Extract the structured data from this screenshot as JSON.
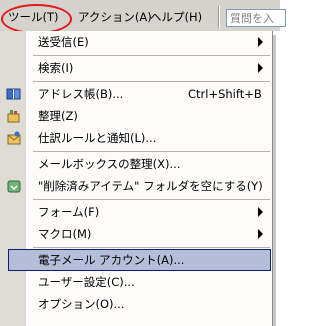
{
  "menubar": {
    "tools_label": "ツール(T)",
    "action_label": "アクション(A)",
    "help_label": "ヘルプ(H)",
    "question_placeholder": "質問を入"
  },
  "menu": {
    "send_receive": "送受信(E)",
    "search": "検索(I)",
    "address_book": "アドレス帳(B)...",
    "address_book_shortcut": "Ctrl+Shift+B",
    "organize": "整理(Z)",
    "rules_alerts": "仕訳ルールと通知(L)...",
    "mailbox_cleanup": "メールボックスの整理(X)...",
    "empty_deleted": "\"削除済みアイテム\" フォルダを空にする(Y)",
    "forms": "フォーム(F)",
    "macro": "マクロ(M)",
    "email_accounts": "電子メール アカウント(A)...",
    "customize": "ユーザー設定(C)...",
    "options": "オプション(O)..."
  },
  "colors": {
    "highlight": "#b4bed8",
    "annotation_ellipse": "#e21a1a"
  }
}
